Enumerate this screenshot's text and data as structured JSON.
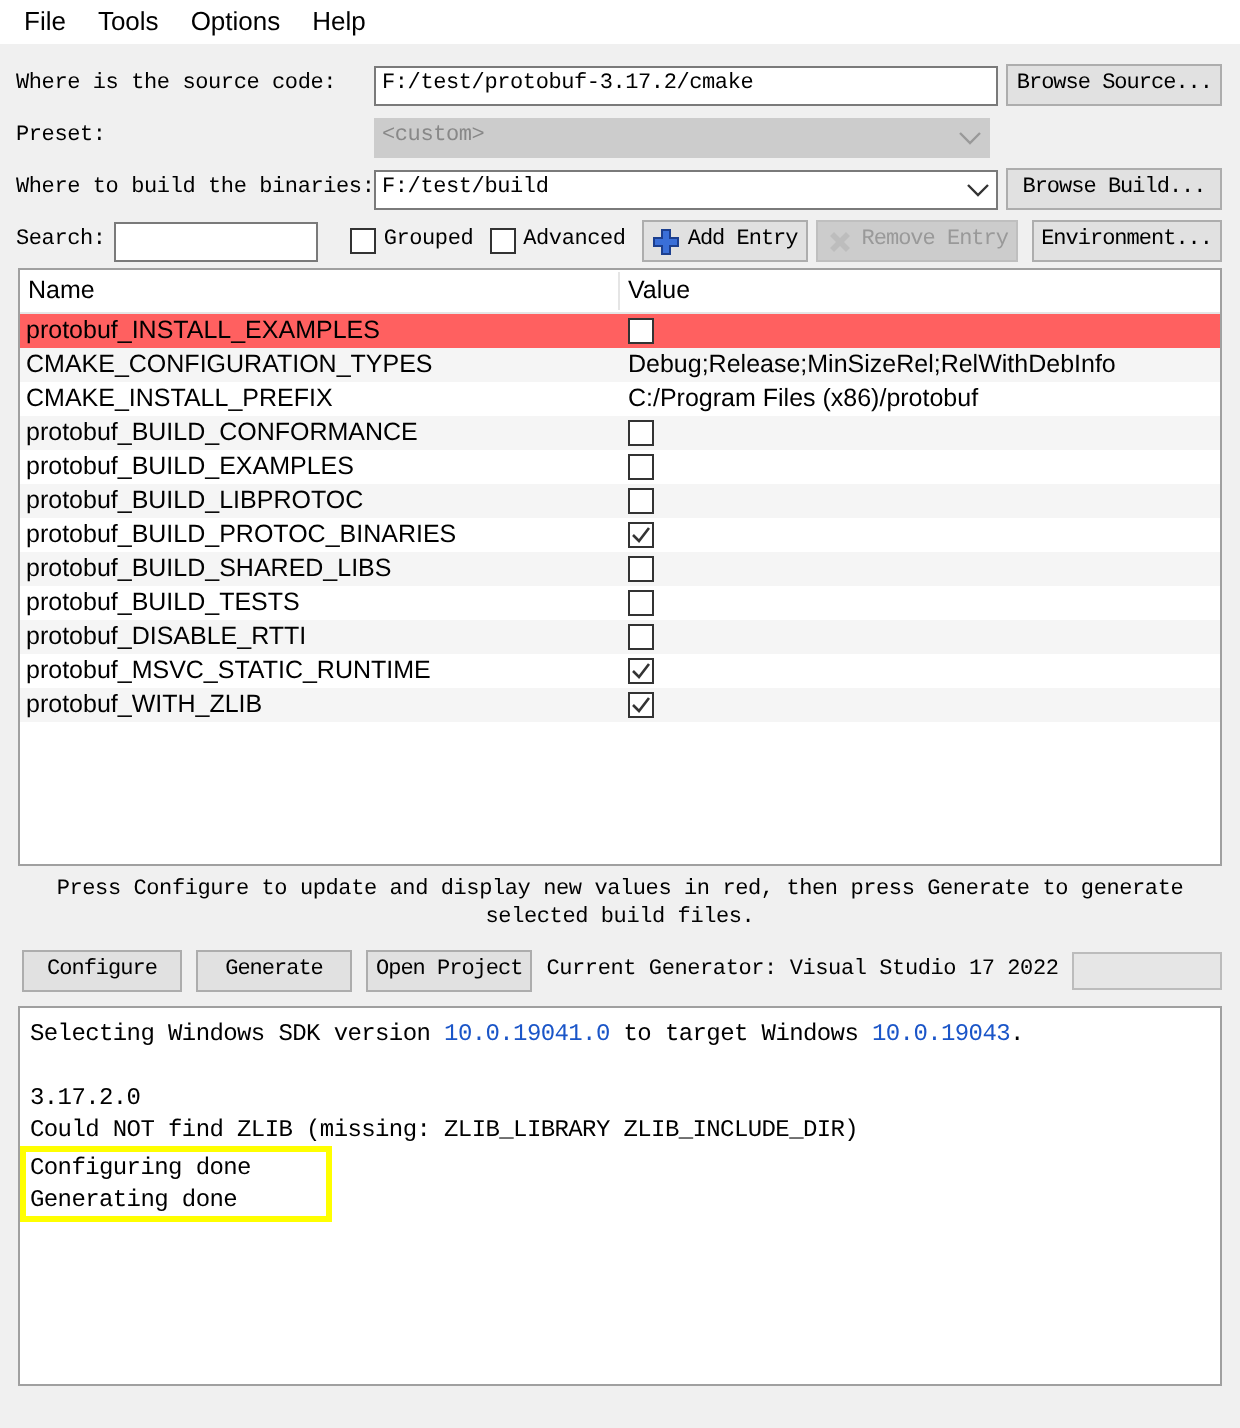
{
  "menu": [
    "File",
    "Tools",
    "Options",
    "Help"
  ],
  "source": {
    "label": "Where is the source code:",
    "value": "F:/test/protobuf-3.17.2/cmake",
    "button": "Browse Source..."
  },
  "preset": {
    "label": "Preset:",
    "value": "<custom>",
    "disabled": true
  },
  "build": {
    "label": "Where to build the binaries:",
    "value": "F:/test/build",
    "button": "Browse Build..."
  },
  "toolbar": {
    "search_label": "Search:",
    "grouped": {
      "label": "Grouped",
      "checked": false
    },
    "advanced": {
      "label": "Advanced",
      "checked": false
    },
    "add_entry": {
      "label": "Add Entry",
      "disabled": false
    },
    "remove_entry": {
      "label": "Remove Entry",
      "disabled": true
    },
    "environment": "Environment..."
  },
  "table": {
    "columns": [
      "Name",
      "Value"
    ],
    "rows": [
      {
        "name": "protobuf_INSTALL_EXAMPLES",
        "kind": "bool",
        "checked": false,
        "new": true
      },
      {
        "name": "CMAKE_CONFIGURATION_TYPES",
        "kind": "text",
        "value": "Debug;Release;MinSizeRel;RelWithDebInfo",
        "new": false
      },
      {
        "name": "CMAKE_INSTALL_PREFIX",
        "kind": "text",
        "value": "C:/Program Files (x86)/protobuf",
        "new": false
      },
      {
        "name": "protobuf_BUILD_CONFORMANCE",
        "kind": "bool",
        "checked": false,
        "new": false
      },
      {
        "name": "protobuf_BUILD_EXAMPLES",
        "kind": "bool",
        "checked": false,
        "new": false
      },
      {
        "name": "protobuf_BUILD_LIBPROTOC",
        "kind": "bool",
        "checked": false,
        "new": false
      },
      {
        "name": "protobuf_BUILD_PROTOC_BINARIES",
        "kind": "bool",
        "checked": true,
        "new": false
      },
      {
        "name": "protobuf_BUILD_SHARED_LIBS",
        "kind": "bool",
        "checked": false,
        "new": false
      },
      {
        "name": "protobuf_BUILD_TESTS",
        "kind": "bool",
        "checked": false,
        "new": false
      },
      {
        "name": "protobuf_DISABLE_RTTI",
        "kind": "bool",
        "checked": false,
        "new": false
      },
      {
        "name": "protobuf_MSVC_STATIC_RUNTIME",
        "kind": "bool",
        "checked": true,
        "new": false
      },
      {
        "name": "protobuf_WITH_ZLIB",
        "kind": "bool",
        "checked": true,
        "new": false
      }
    ]
  },
  "hint": "Press Configure to update and display new values in red, then press Generate to generate selected build files.",
  "actions": [
    "Configure",
    "Generate",
    "Open Project"
  ],
  "generator": "Current Generator: Visual Studio 17 2022",
  "progress": {
    "level": 0
  },
  "log": [
    {
      "segments": [
        {
          "text": "Selecting Windows SDK version ",
          "kind": "plain"
        },
        {
          "text": "10.0.19041.0",
          "kind": "number"
        },
        {
          "text": " to target Windows ",
          "kind": "plain"
        },
        {
          "text": "10.0.19043",
          "kind": "number"
        },
        {
          "text": ".",
          "kind": "plain"
        }
      ],
      "highlighted": false
    },
    {
      "kind": "blank"
    },
    {
      "segments": [
        {
          "text": "3.17.2.0",
          "kind": "plain"
        }
      ],
      "highlighted": false
    },
    {
      "segments": [
        {
          "text": "Could NOT find ZLIB (missing: ZLIB_LIBRARY ZLIB_INCLUDE_DIR)",
          "kind": "plain"
        }
      ],
      "highlighted": false
    },
    {
      "segments": [
        {
          "text": "Configuring done",
          "kind": "plain"
        }
      ],
      "highlighted": true
    },
    {
      "segments": [
        {
          "text": "Generating done",
          "kind": "plain"
        }
      ],
      "highlighted": true
    }
  ]
}
